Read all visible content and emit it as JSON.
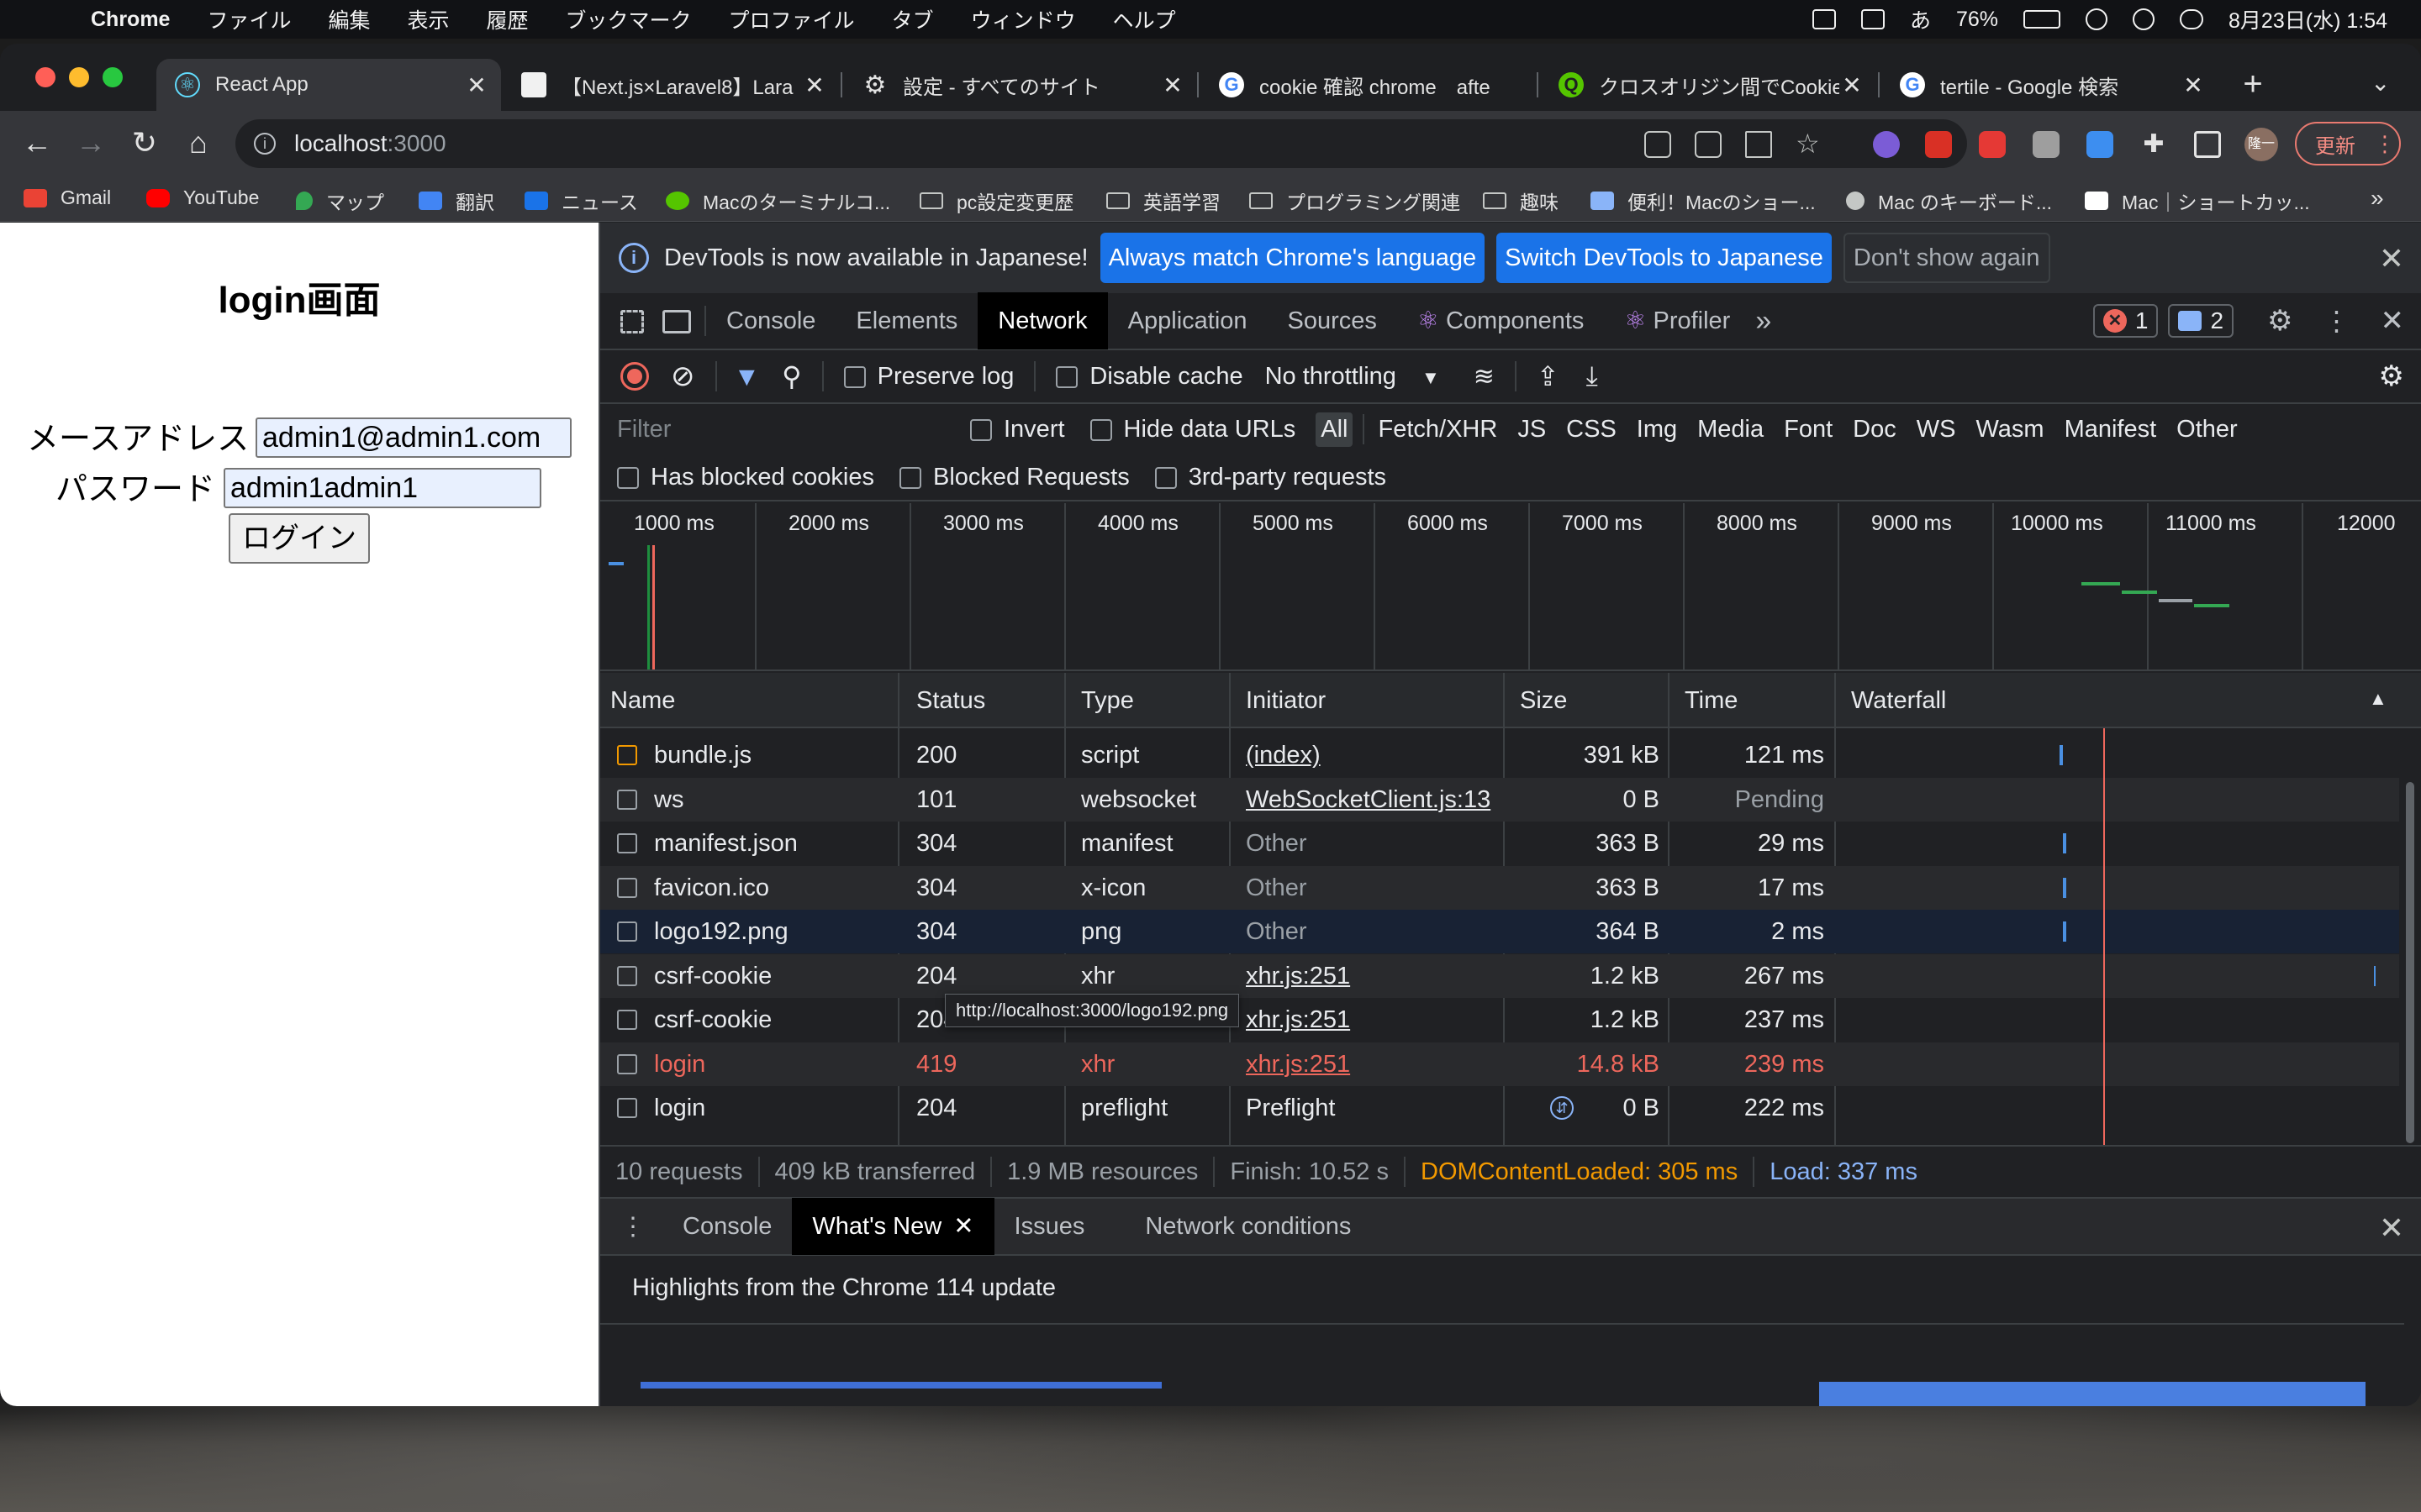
{
  "menubar": {
    "app_name": "Chrome",
    "items": [
      "ファイル",
      "編集",
      "表示",
      "履歴",
      "ブックマーク",
      "プロファイル",
      "タブ",
      "ウィンドウ",
      "ヘルプ"
    ],
    "input_method": "あ",
    "battery": "76%",
    "datetime": "8月23日(水) 1:54"
  },
  "tabs": [
    {
      "title": "React App",
      "icon": "react-icon",
      "active": true
    },
    {
      "title": "【Next.js×Laravel8】Lara",
      "icon": "page-icon"
    },
    {
      "title": "設定 - すべてのサイト",
      "icon": "gear-icon"
    },
    {
      "title": "cookie 確認 chrome　afte",
      "icon": "google-icon"
    },
    {
      "title": "クロスオリジン間でCookie",
      "icon": "qiita-icon"
    },
    {
      "title": "tertile - Google 検索",
      "icon": "google-icon"
    }
  ],
  "toolbar": {
    "url_host": "localhost",
    "url_port": ":3000",
    "update_label": "更新",
    "avatar_label": "隆一"
  },
  "bookmarks": [
    {
      "label": "Gmail",
      "icon": "gmail-icon"
    },
    {
      "label": "YouTube",
      "icon": "youtube-icon"
    },
    {
      "label": "マップ",
      "icon": "maps-icon"
    },
    {
      "label": "翻訳",
      "icon": "translate-icon"
    },
    {
      "label": "ニュース",
      "icon": "news-icon"
    },
    {
      "label": "Macのターミナルコ...",
      "icon": "qiita-icon"
    },
    {
      "label": "pc設定変更歴",
      "icon": "folder-icon"
    },
    {
      "label": "英語学習",
      "icon": "folder-icon"
    },
    {
      "label": "プログラミング関連",
      "icon": "folder-icon"
    },
    {
      "label": "趣味",
      "icon": "folder-icon"
    },
    {
      "label": "便利！Macのショー...",
      "icon": "chart-icon"
    },
    {
      "label": "Mac のキーボード...",
      "icon": "apple-icon"
    },
    {
      "label": "Mac｜ショートカッ...",
      "icon": "pc-icon"
    }
  ],
  "page": {
    "title": "login画面",
    "email_label": "メースアドレス",
    "email_value": "admin1@admin1.com",
    "password_label": "パスワード",
    "password_value": "admin1admin1",
    "login_button": "ログイン"
  },
  "devtools": {
    "infobar": {
      "message": "DevTools is now available in Japanese!",
      "btn_match": "Always match Chrome's language",
      "btn_switch": "Switch DevTools to Japanese",
      "btn_dismiss": "Don't show again"
    },
    "tabs": [
      "Console",
      "Elements",
      "Network",
      "Application",
      "Sources",
      "Components",
      "Profiler"
    ],
    "active_tab": "Network",
    "error_count": "1",
    "message_count": "2",
    "network_toolbar": {
      "preserve_log": "Preserve log",
      "disable_cache": "Disable cache",
      "throttling": "No throttling"
    },
    "filter": {
      "placeholder": "Filter",
      "invert": "Invert",
      "hide_data_urls": "Hide data URLs",
      "types": [
        "All",
        "Fetch/XHR",
        "JS",
        "CSS",
        "Img",
        "Media",
        "Font",
        "Doc",
        "WS",
        "Wasm",
        "Manifest",
        "Other"
      ],
      "has_blocked_cookies": "Has blocked cookies",
      "blocked_requests": "Blocked Requests",
      "third_party": "3rd-party requests"
    },
    "timeline_ticks": [
      "1000 ms",
      "2000 ms",
      "3000 ms",
      "4000 ms",
      "5000 ms",
      "6000 ms",
      "7000 ms",
      "8000 ms",
      "9000 ms",
      "10000 ms",
      "11000 ms",
      "12000"
    ],
    "columns": [
      "Name",
      "Status",
      "Type",
      "Initiator",
      "Size",
      "Time",
      "Waterfall"
    ],
    "rows": [
      {
        "name": "bundle.js",
        "status": "200",
        "type": "script",
        "initiator": "(index)",
        "size": "391 kB",
        "time": "121 ms"
      },
      {
        "name": "ws",
        "status": "101",
        "type": "websocket",
        "initiator": "WebSocketClient.js:13",
        "size": "0 B",
        "time": "Pending"
      },
      {
        "name": "manifest.json",
        "status": "304",
        "type": "manifest",
        "initiator": "Other",
        "size": "363 B",
        "time": "29 ms"
      },
      {
        "name": "favicon.ico",
        "status": "304",
        "type": "x-icon",
        "initiator": "Other",
        "size": "363 B",
        "time": "17 ms"
      },
      {
        "name": "logo192.png",
        "status": "304",
        "type": "png",
        "initiator": "Other",
        "size": "364 B",
        "time": "2 ms"
      },
      {
        "name": "csrf-cookie",
        "status": "204",
        "type": "xhr",
        "initiator": "xhr.js:251",
        "size": "1.2 kB",
        "time": "267 ms"
      },
      {
        "name": "csrf-cookie",
        "status": "204",
        "type": "xhr",
        "initiator": "xhr.js:251",
        "size": "1.2 kB",
        "time": "237 ms"
      },
      {
        "name": "login",
        "status": "419",
        "type": "xhr",
        "initiator": "xhr.js:251",
        "size": "14.8 kB",
        "time": "239 ms"
      },
      {
        "name": "login",
        "status": "204",
        "type": "preflight",
        "initiator": "Preflight",
        "size": "0 B",
        "time": "222 ms"
      }
    ],
    "tooltip": "http://localhost:3000/logo192.png",
    "summary": {
      "requests": "10 requests",
      "transferred": "409 kB transferred",
      "resources": "1.9 MB resources",
      "finish": "Finish: 10.52 s",
      "dom_content_loaded": "DOMContentLoaded: 305 ms",
      "load": "Load: 337 ms"
    },
    "drawer": {
      "tabs": [
        "Console",
        "What's New",
        "Issues",
        "Network conditions"
      ],
      "active_tab": "What's New",
      "highlights": "Highlights from the Chrome 114 update"
    }
  },
  "colors": {
    "error_red": "#ee675c",
    "accent_blue": "#1a73e8",
    "dcl_orange": "#f29900"
  }
}
